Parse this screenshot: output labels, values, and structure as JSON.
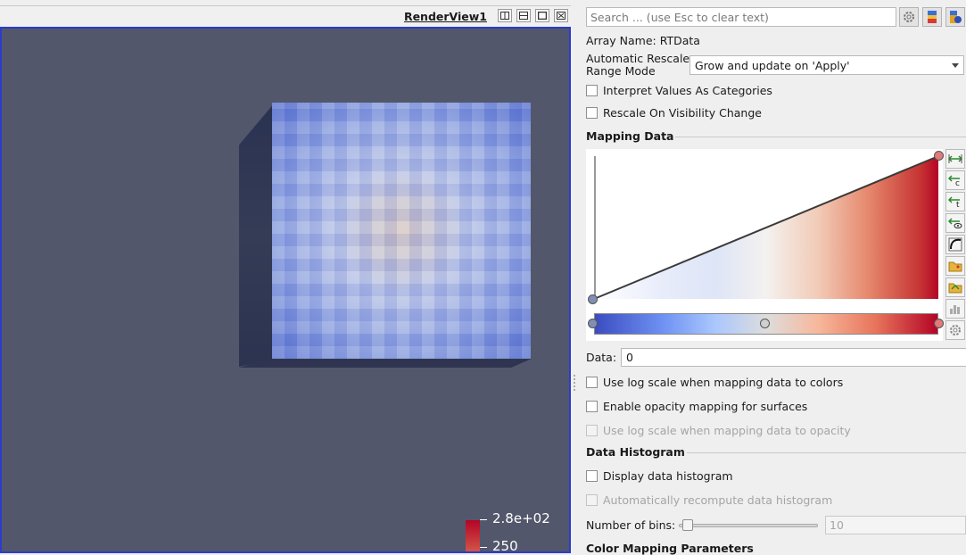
{
  "render_view": {
    "title": "RenderView1",
    "buttons": [
      "split-horizontal-icon",
      "split-vertical-icon",
      "maximize-icon",
      "close-icon"
    ],
    "background_color": "#52576b",
    "legend": {
      "labels": [
        "2.8e+02",
        "250"
      ]
    }
  },
  "panel": {
    "search_placeholder": "Search ... (use Esc to clear text)",
    "toolbar_icons": [
      "gear-icon",
      "color-palette-icon",
      "choose-preset-icon"
    ],
    "array_name": "Array Name: RTData",
    "rescale_label_line1": "Automatic Rescale",
    "rescale_label_line2": "Range Mode",
    "rescale_mode": "Grow and update on 'Apply'",
    "interpret_categories": "Interpret Values As Categories",
    "rescale_visibility": "Rescale On Visibility Change",
    "mapping_data_title": "Mapping Data",
    "data_label": "Data:",
    "data_value": "0",
    "use_log_colors": "Use log scale when mapping data to colors",
    "enable_opacity": "Enable opacity mapping for surfaces",
    "use_log_opacity": "Use log scale when mapping data to opacity",
    "histogram_title": "Data Histogram",
    "display_histogram": "Display data histogram",
    "auto_recompute": "Automatically recompute data histogram",
    "bins_label": "Number of bins:",
    "bins_value": "10",
    "bins_slider_level": 0.0,
    "color_params_title": "Color Mapping Parameters"
  }
}
